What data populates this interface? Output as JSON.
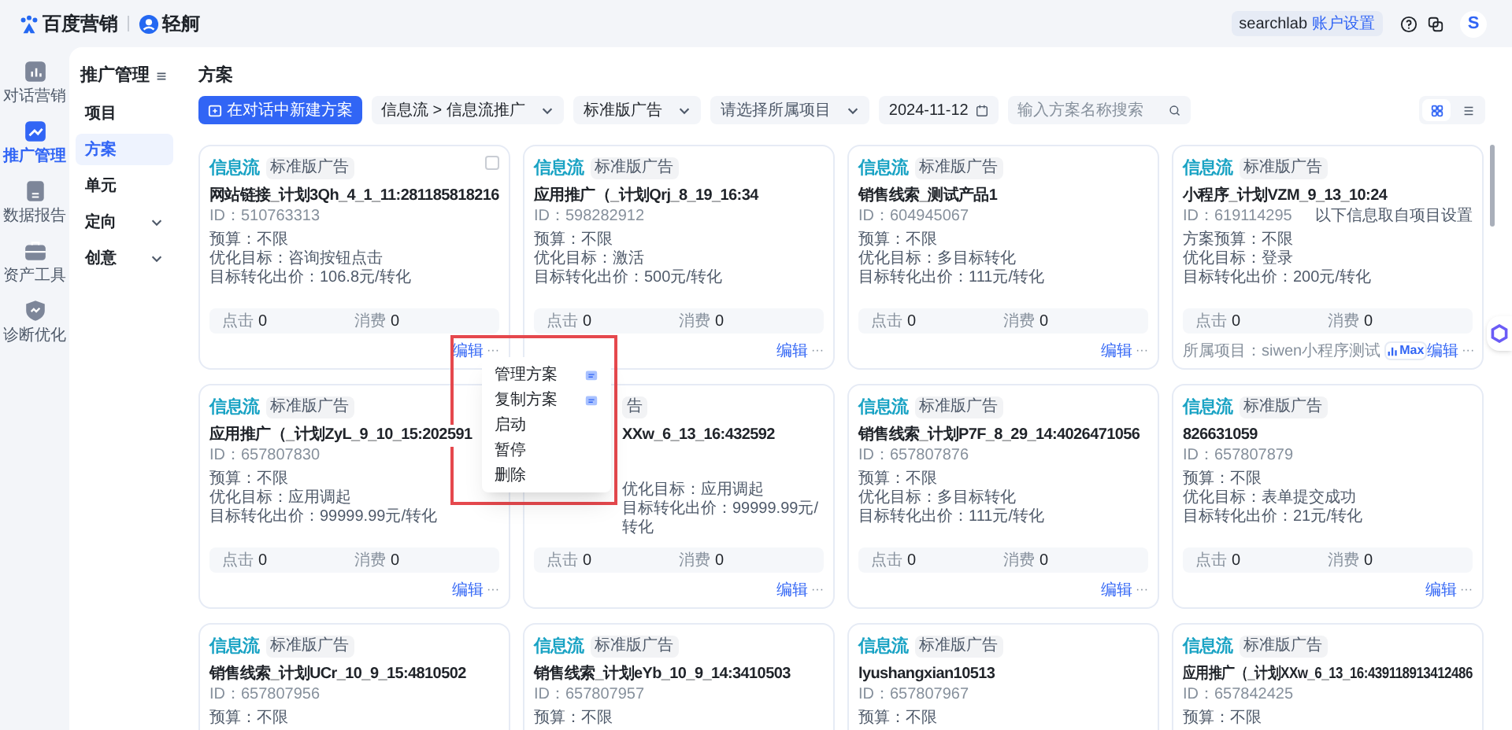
{
  "header": {
    "brand": "百度营销",
    "product": "轻舸",
    "account": "searchlab",
    "account_link": "账户设置",
    "avatar": "S"
  },
  "rail": [
    {
      "label": "对话营销",
      "selected": false
    },
    {
      "label": "推广管理",
      "selected": true
    },
    {
      "label": "数据报告",
      "selected": false
    },
    {
      "label": "资产工具",
      "selected": false
    },
    {
      "label": "诊断优化",
      "selected": false
    }
  ],
  "nav": {
    "title": "推广管理",
    "items": [
      {
        "label": "项目",
        "selected": false
      },
      {
        "label": "方案",
        "selected": true
      },
      {
        "label": "单元",
        "selected": false
      },
      {
        "label": "定向",
        "selected": false,
        "expanded": false
      },
      {
        "label": "创意",
        "selected": false,
        "expanded": false
      }
    ]
  },
  "page": {
    "title": "方案"
  },
  "toolbar": {
    "create_button": "在对话中新建方案",
    "filters": [
      {
        "value": "信息流 > 信息流推广"
      },
      {
        "value": "标准版广告"
      },
      {
        "placeholder": "请选择所属项目"
      }
    ],
    "date": "2024-11-12",
    "search": {
      "placeholder": "输入方案名称搜索"
    },
    "views": [
      {
        "selected": true
      },
      {
        "selected": false
      }
    ]
  },
  "cards": [
    {
      "kind": "normal",
      "tag": "信息流",
      "badge": "标准版广告",
      "title": "网站链接_计划3Qh_4_1_11:281185818216",
      "id": "ID：510763313",
      "details": [
        "预算：不限",
        "优化目标：咨询按钮点击",
        "目标转化出价：106.8元/转化"
      ],
      "stats": [
        {
          "label": "点击",
          "value": "0"
        },
        {
          "label": "消费",
          "value": "0"
        }
      ],
      "edit": "编辑",
      "more": "···",
      "checkbox": {
        "checked": false
      }
    },
    {
      "kind": "normal",
      "tag": "信息流",
      "badge": "标准版广告",
      "title": "应用推广（_计划Qrj_8_19_16:34",
      "id": "ID：598282912",
      "details": [
        "预算：不限",
        "优化目标：激活",
        "目标转化出价：500元/转化"
      ],
      "stats": [
        {
          "label": "点击",
          "value": "0"
        },
        {
          "label": "消费",
          "value": "0"
        }
      ],
      "edit": "编辑",
      "more": "···"
    },
    {
      "kind": "normal",
      "tag": "信息流",
      "badge": "标准版广告",
      "title": "销售线索_测试产品1",
      "id": "ID：604945067",
      "details": [
        "预算：不限",
        "优化目标：多目标转化",
        "目标转化出价：111元/转化"
      ],
      "stats": [
        {
          "label": "点击",
          "value": "0"
        },
        {
          "label": "消费",
          "value": "0"
        }
      ],
      "edit": "编辑",
      "more": "···"
    },
    {
      "kind": "normal",
      "tag": "信息流",
      "badge": "标准版广告",
      "title": "小程序_计划VZM_9_13_10:24",
      "id": "ID：619114295",
      "note": "以下信息取自项目设置",
      "details": [
        "方案预算：不限",
        "优化目标：登录",
        "目标转化出价：200元/转化"
      ],
      "stats": [
        {
          "label": "点击",
          "value": "0"
        },
        {
          "label": "消费",
          "value": "0"
        }
      ],
      "project": "所属项目：siwen小程序测试",
      "project_badge": "Max",
      "edit": "编辑",
      "more": "···"
    },
    {
      "kind": "normal",
      "tag": "信息流",
      "badge": "标准版广告",
      "title": "应用推广（_计划ZyL_9_10_15:202591",
      "id": "ID：657807830",
      "details": [
        "预算：不限",
        "优化目标：应用调起",
        "目标转化出价：99999.99元/转化"
      ],
      "stats": [
        {
          "label": "点击",
          "value": "0"
        },
        {
          "label": "消费",
          "value": "0"
        }
      ],
      "edit": "编辑",
      "more": "···"
    },
    {
      "kind": "covered",
      "badge": "告",
      "title": "XXw_6_13_16:432592",
      "details": [
        "优化目标：应用调起",
        "目标转化出价：99999.99元/转化"
      ],
      "stats": [
        {
          "label": "点击",
          "value": "0"
        },
        {
          "label": "消费",
          "value": "0"
        }
      ],
      "edit": "编辑",
      "more": "···"
    },
    {
      "kind": "normal",
      "tag": "信息流",
      "badge": "标准版广告",
      "title": "销售线索_计划P7F_8_29_14:4026471056",
      "id": "ID：657807876",
      "details": [
        "预算：不限",
        "优化目标：多目标转化",
        "目标转化出价：111元/转化"
      ],
      "stats": [
        {
          "label": "点击",
          "value": "0"
        },
        {
          "label": "消费",
          "value": "0"
        }
      ],
      "edit": "编辑",
      "more": "···"
    },
    {
      "kind": "normal",
      "tag": "信息流",
      "badge": "标准版广告",
      "title": "826631059",
      "id": "ID：657807879",
      "details": [
        "预算：不限",
        "优化目标：表单提交成功",
        "目标转化出价：21元/转化"
      ],
      "stats": [
        {
          "label": "点击",
          "value": "0"
        },
        {
          "label": "消费",
          "value": "0"
        }
      ],
      "edit": "编辑",
      "more": "···"
    },
    {
      "kind": "normal",
      "tag": "信息流",
      "badge": "标准版广告",
      "title": "销售线索_计划UCr_10_9_15:4810502",
      "id": "ID：657807956",
      "details": [
        "预算：不限"
      ]
    },
    {
      "kind": "normal",
      "tag": "信息流",
      "badge": "标准版广告",
      "title": "销售线索_计划eYb_10_9_14:3410503",
      "id": "ID：657807957",
      "details": [
        "预算：不限"
      ]
    },
    {
      "kind": "normal",
      "tag": "信息流",
      "badge": "标准版广告",
      "title": "lyushangxian10513",
      "id": "ID：657807967",
      "details": [
        "预算：不限"
      ]
    },
    {
      "kind": "normal",
      "tag": "信息流",
      "badge": "标准版广告",
      "title": "应用推广（_计划XXw_6_13_16:439118913412486",
      "id": "ID：657842425",
      "details": [
        "预算：不限"
      ]
    }
  ],
  "menu": {
    "items": [
      {
        "label": "管理方案",
        "kind": "with_icon"
      },
      {
        "label": "复制方案",
        "kind": "with_icon"
      },
      {
        "label": "启动",
        "kind": "plain"
      },
      {
        "label": "暂停",
        "kind": "plain"
      },
      {
        "label": "删除",
        "kind": "plain"
      }
    ]
  }
}
